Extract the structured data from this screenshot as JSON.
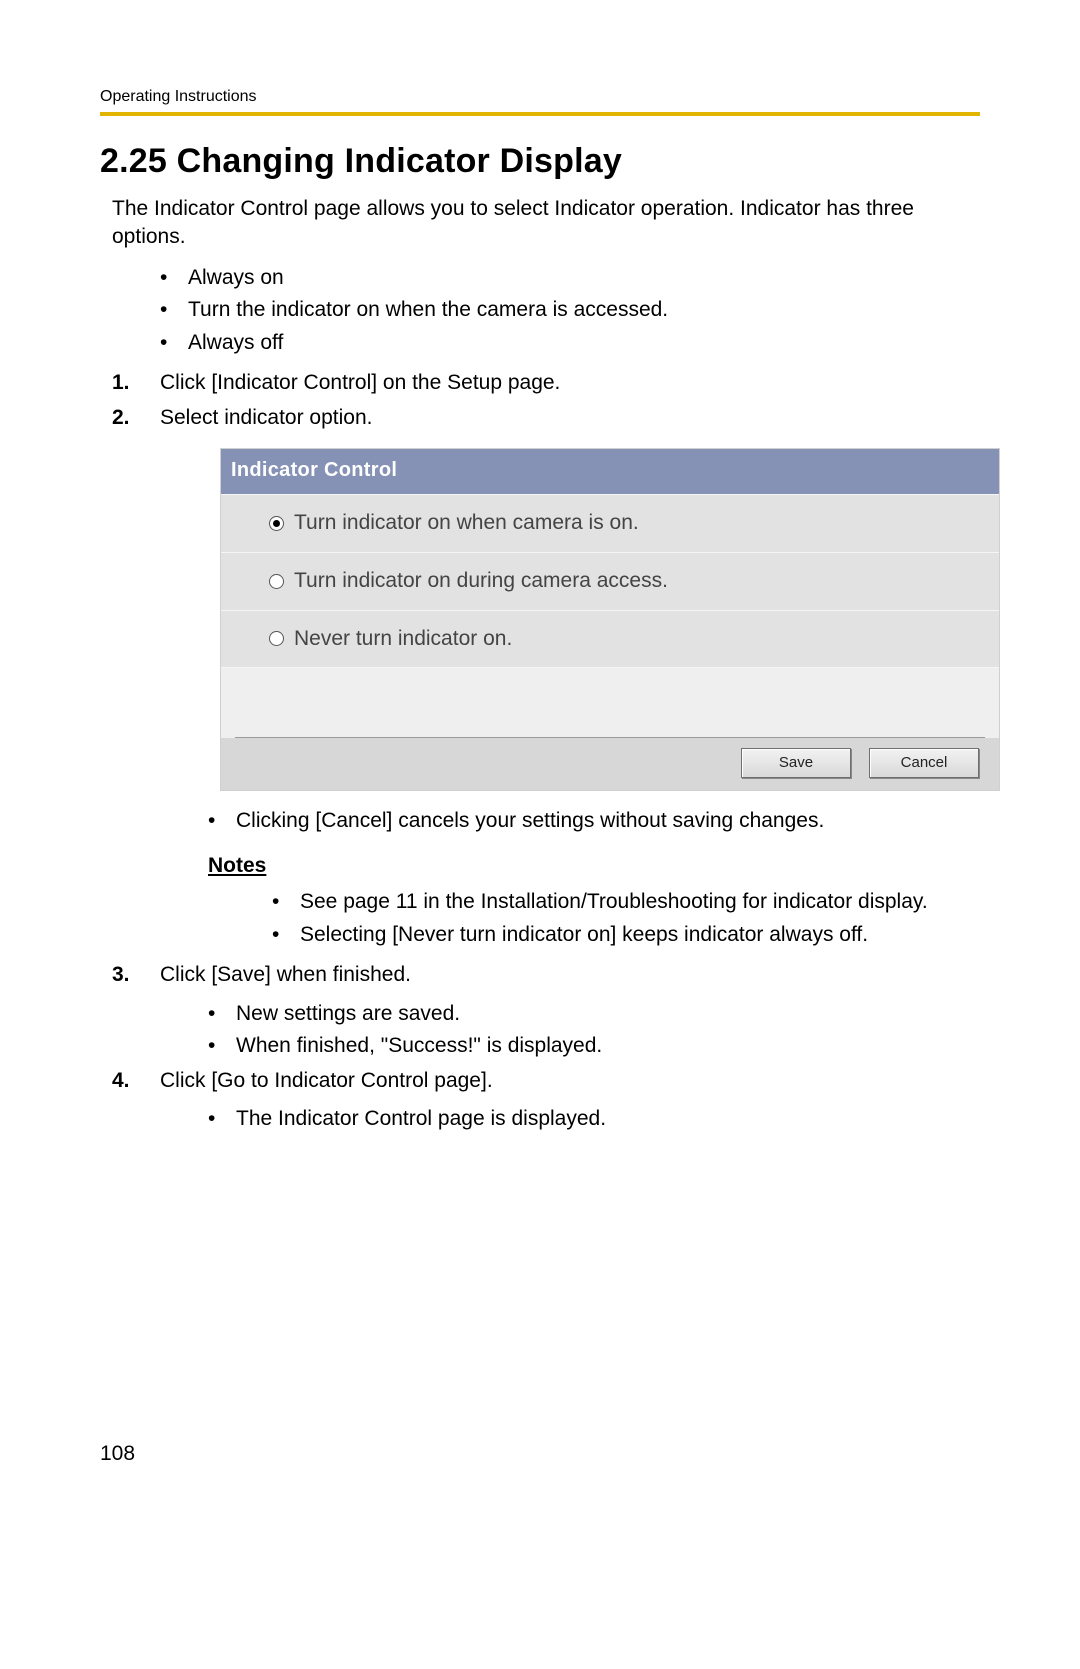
{
  "header": {
    "running_head": "Operating Instructions"
  },
  "title": "2.25  Changing Indicator Display",
  "intro": "The Indicator Control page allows you to select Indicator operation. Indicator has three options.",
  "options_list": [
    "Always on",
    "Turn the indicator on when the camera is accessed.",
    "Always off"
  ],
  "steps": {
    "s1": {
      "num": "1.",
      "text": "Click [Indicator Control] on the Setup page."
    },
    "s2": {
      "num": "2.",
      "text": "Select indicator option."
    },
    "s3": {
      "num": "3.",
      "text": "Click [Save] when finished."
    },
    "s4": {
      "num": "4.",
      "text": "Click [Go to Indicator Control page]."
    }
  },
  "panel": {
    "title": "Indicator Control",
    "options": {
      "o1": "Turn indicator on when camera is on.",
      "o2": "Turn indicator on during camera access.",
      "o3": "Never turn indicator on."
    },
    "save_label": "Save",
    "cancel_label": "Cancel"
  },
  "after_panel_note": "Clicking [Cancel] cancels your settings without saving changes.",
  "notes": {
    "heading": "Notes",
    "items": [
      "See page 11 in the Installation/Troubleshooting for indicator display.",
      "Selecting [Never turn indicator on] keeps indicator always off."
    ]
  },
  "step3_sub": [
    "New settings are saved.",
    "When finished, \"Success!\" is displayed."
  ],
  "step4_sub": [
    "The Indicator Control page is displayed."
  ],
  "page_number": "108"
}
